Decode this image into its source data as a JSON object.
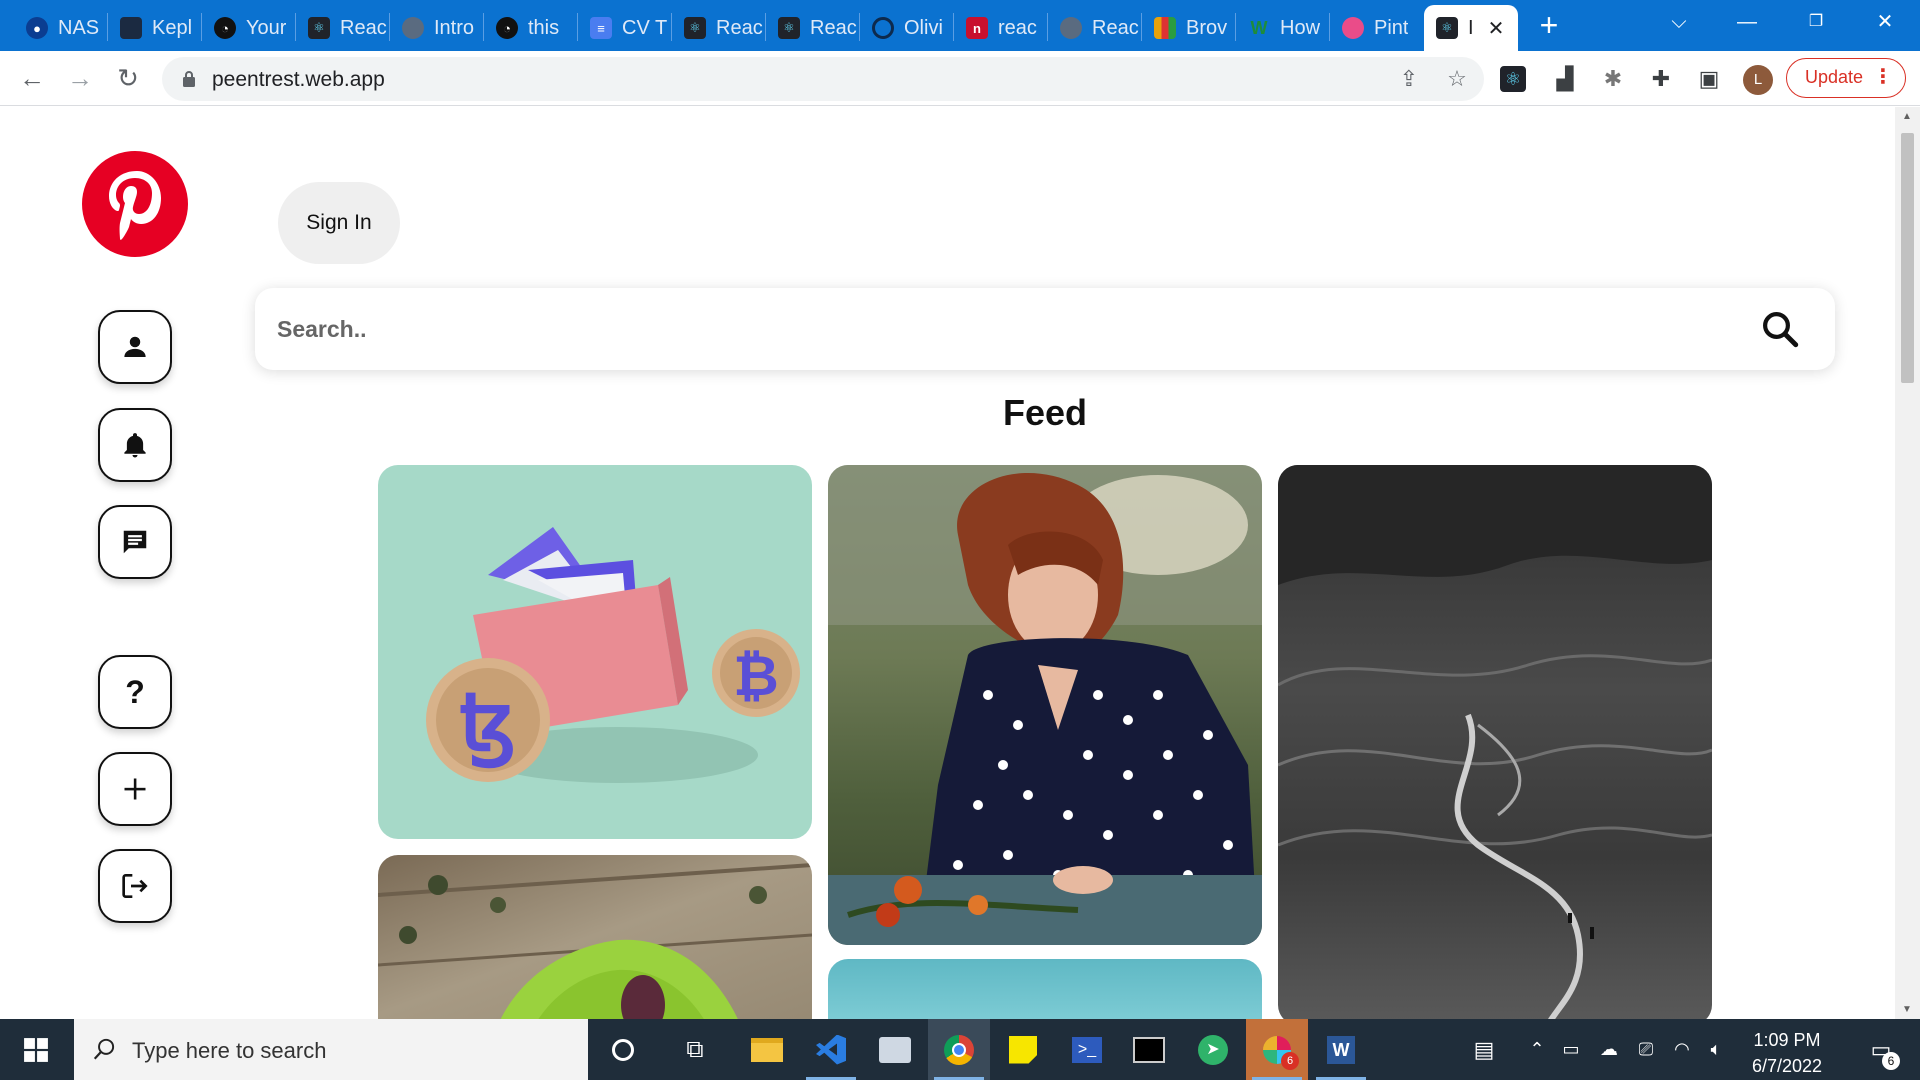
{
  "browser": {
    "tabs": [
      {
        "title": "NAS",
        "favicon": "nasa-icon",
        "color": "#0b3d91"
      },
      {
        "title": "Kepl",
        "favicon": "kepler-icon",
        "color": "#1b2a41"
      },
      {
        "title": "Your",
        "favicon": "github-icon",
        "color": "#111111"
      },
      {
        "title": "Reac",
        "favicon": "react-icon",
        "color": "#20232a"
      },
      {
        "title": "Intro",
        "favicon": "globe-icon",
        "color": "#5a6b80"
      },
      {
        "title": "this",
        "favicon": "github-icon",
        "color": "#111111"
      },
      {
        "title": "CV T",
        "favicon": "docs-icon",
        "color": "#4a7df0"
      },
      {
        "title": "Reac",
        "favicon": "react-icon",
        "color": "#20232a"
      },
      {
        "title": "Reac",
        "favicon": "react-icon",
        "color": "#20232a"
      },
      {
        "title": "Olivi",
        "favicon": "ring-icon",
        "color": "#0b72d0"
      },
      {
        "title": "reac",
        "favicon": "netlify-icon",
        "color": "#c8102e"
      },
      {
        "title": "Reac",
        "favicon": "globe-icon",
        "color": "#5a6b80"
      },
      {
        "title": "Brov",
        "favicon": "colorbars-icon",
        "color": "#e8a20b"
      },
      {
        "title": "How",
        "favicon": "w-icon",
        "color": "#1e8c3a"
      },
      {
        "title": "Pint",
        "favicon": "dribbble-icon",
        "color": "#ea4c89"
      }
    ],
    "active_tab": {
      "title": "I",
      "favicon": "react-icon",
      "color": "#20232a"
    },
    "url": "peentrest.web.app",
    "update_label": "Update",
    "profile_initial": "L"
  },
  "sidebar": {
    "buttons": [
      {
        "name": "profile-button",
        "icon": "person-icon"
      },
      {
        "name": "notifications-button",
        "icon": "bell-icon"
      },
      {
        "name": "messages-button",
        "icon": "chat-icon"
      },
      {
        "name": "help-button",
        "icon": "question-icon"
      },
      {
        "name": "create-pin-button",
        "icon": "plus-icon"
      },
      {
        "name": "logout-button",
        "icon": "logout-icon"
      }
    ]
  },
  "header": {
    "signin_label": "Sign In"
  },
  "search": {
    "placeholder": "Search.."
  },
  "feed": {
    "title": "Feed"
  },
  "taskbar": {
    "search_placeholder": "Type here to search",
    "time": "1:09 PM",
    "date": "6/7/2022",
    "notification_count": "6",
    "slack_badge": "6"
  },
  "colors": {
    "brand": "#e60023",
    "tab_strip": "#0b72d0",
    "taskbar": "#1f2d3a"
  }
}
